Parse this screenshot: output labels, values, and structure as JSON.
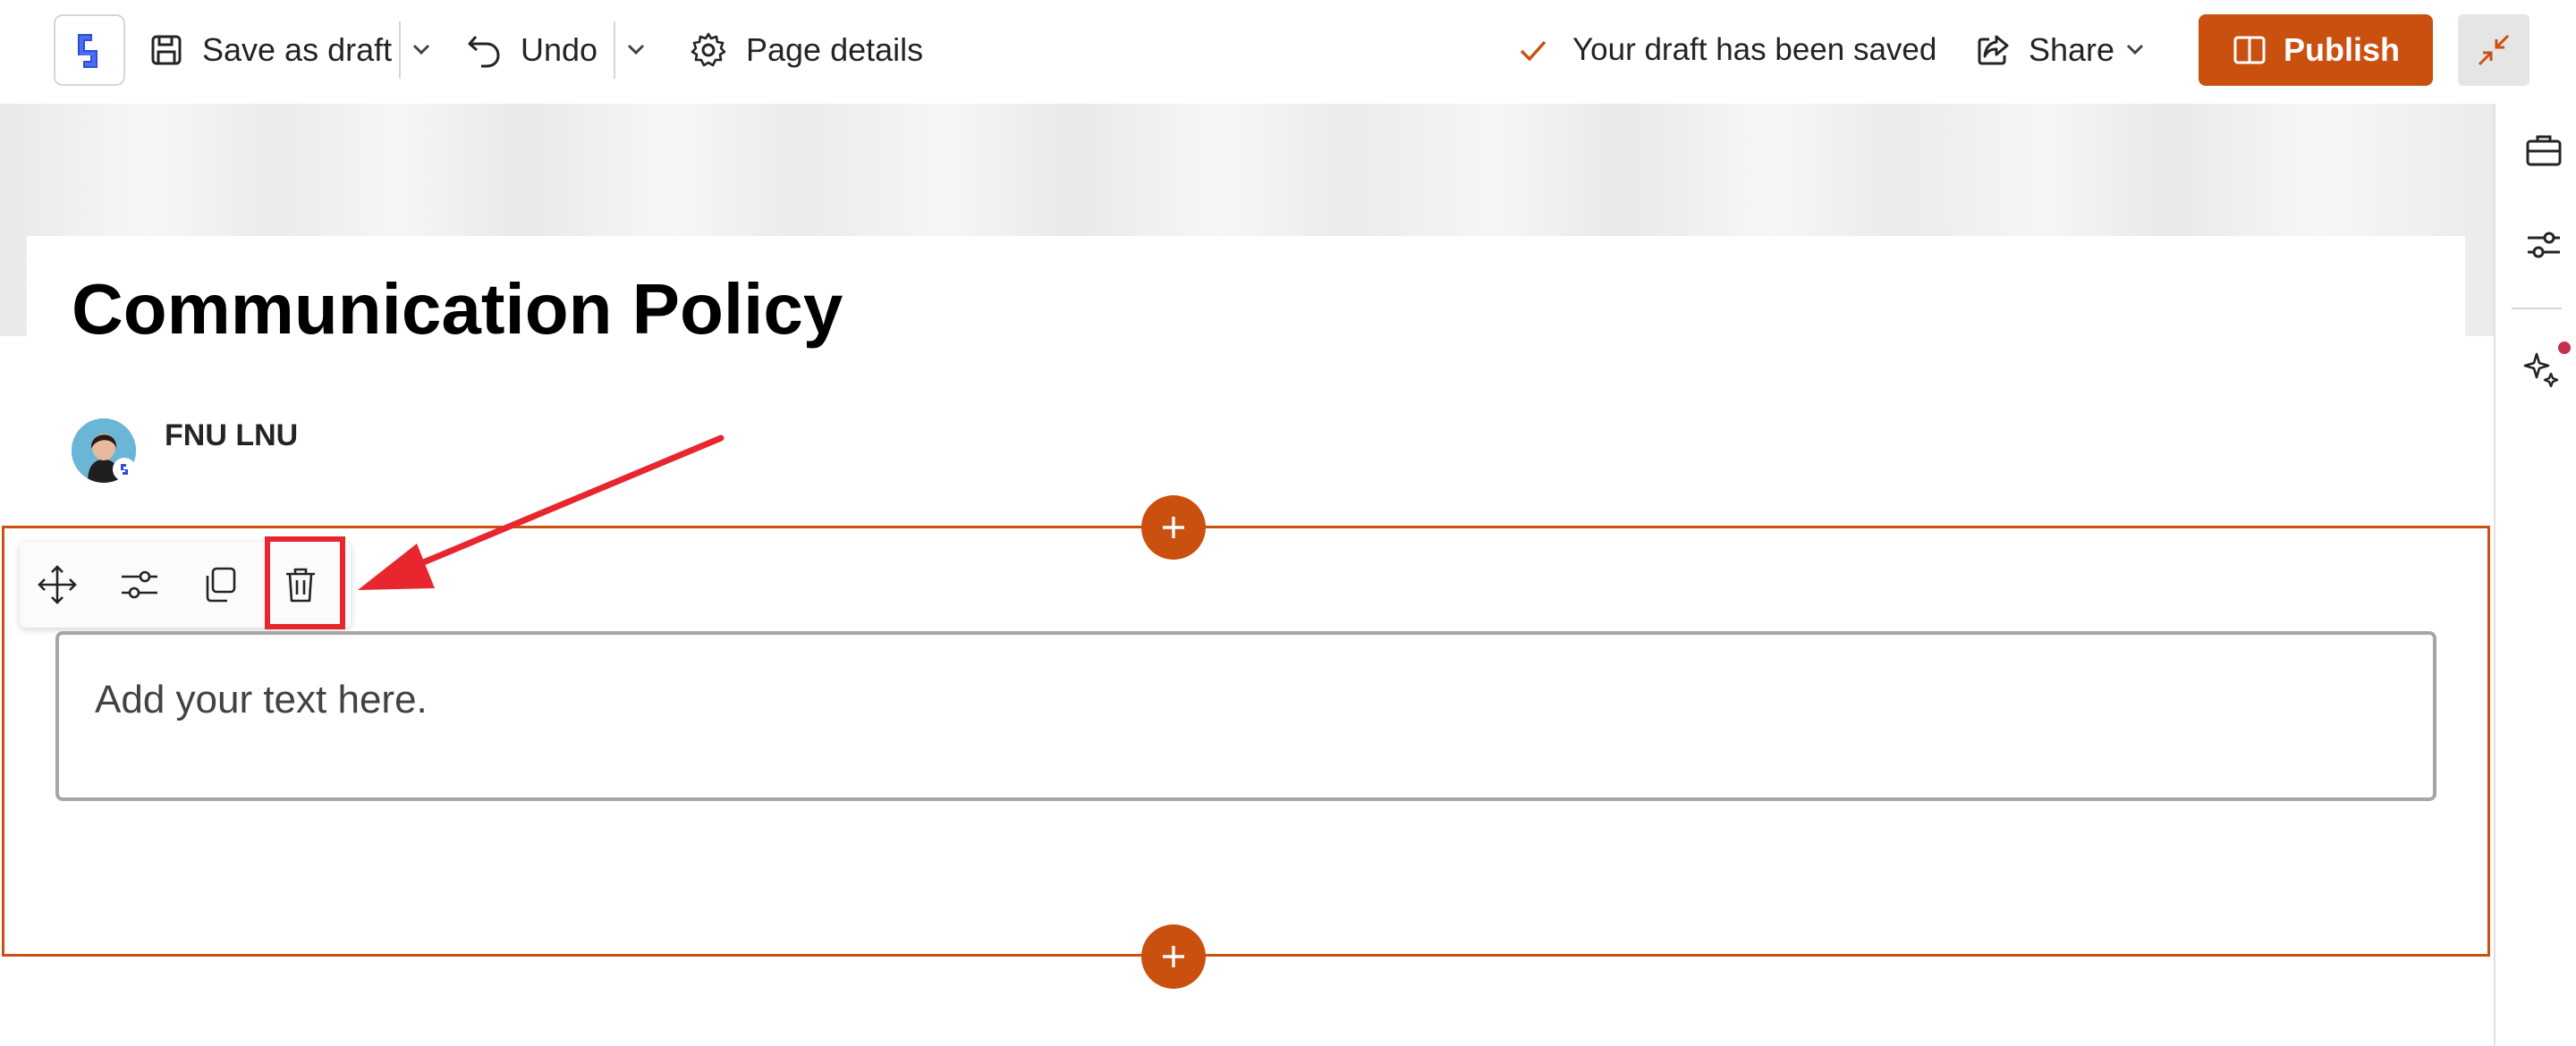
{
  "toolbar": {
    "save_draft_label": "Save as draft",
    "undo_label": "Undo",
    "page_details_label": "Page details",
    "status_text": "Your draft has been saved",
    "share_label": "Share",
    "publish_label": "Publish"
  },
  "page": {
    "title": "Communication Policy",
    "author": "FNU LNU"
  },
  "text_webpart": {
    "placeholder": "Add your text here."
  },
  "webpart_toolbar": {
    "tools": [
      "move-icon",
      "edit-properties-icon",
      "duplicate-icon",
      "delete-icon"
    ]
  },
  "colors": {
    "accent": "#ca5010",
    "annotation": "#e8262d",
    "brand_logo": "#2b4fd8"
  }
}
